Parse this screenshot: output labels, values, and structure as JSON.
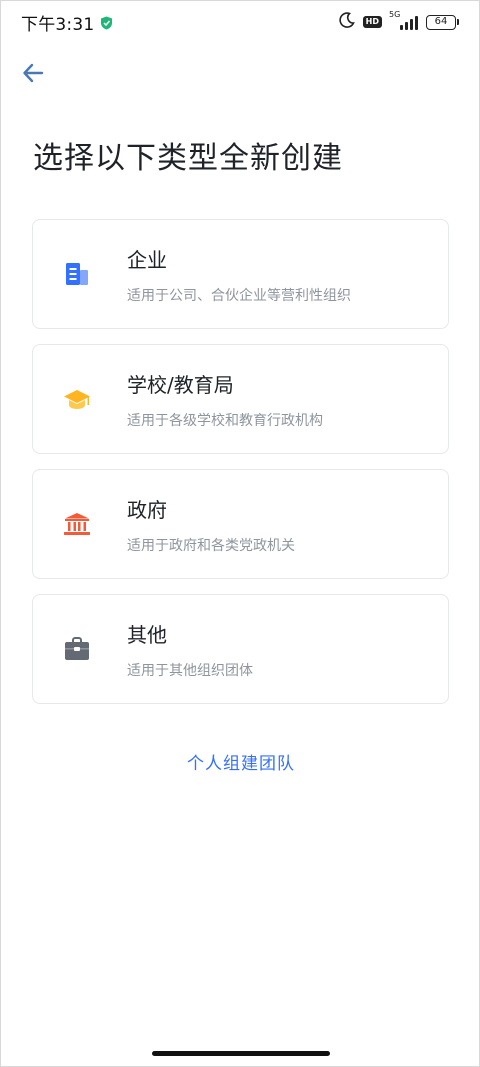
{
  "status_bar": {
    "time": "下午3:31",
    "hd": "HD",
    "network": "5G",
    "battery": "64"
  },
  "page": {
    "title": "选择以下类型全新创建"
  },
  "options": [
    {
      "title": "企业",
      "desc": "适用于公司、合伙企业等营利性组织",
      "icon": "building-icon",
      "color": "#3370ff"
    },
    {
      "title": "学校/教育局",
      "desc": "适用于各级学校和教育行政机构",
      "icon": "graduation-cap-icon",
      "color": "#ffb51f"
    },
    {
      "title": "政府",
      "desc": "适用于政府和各类党政机关",
      "icon": "government-icon",
      "color": "#f25a38"
    },
    {
      "title": "其他",
      "desc": "适用于其他组织团体",
      "icon": "briefcase-icon",
      "color": "#646a73"
    }
  ],
  "footer": {
    "personal_link": "个人组建团队"
  },
  "colors": {
    "accent": "#3370ff",
    "back_arrow": "#4a78b5"
  }
}
